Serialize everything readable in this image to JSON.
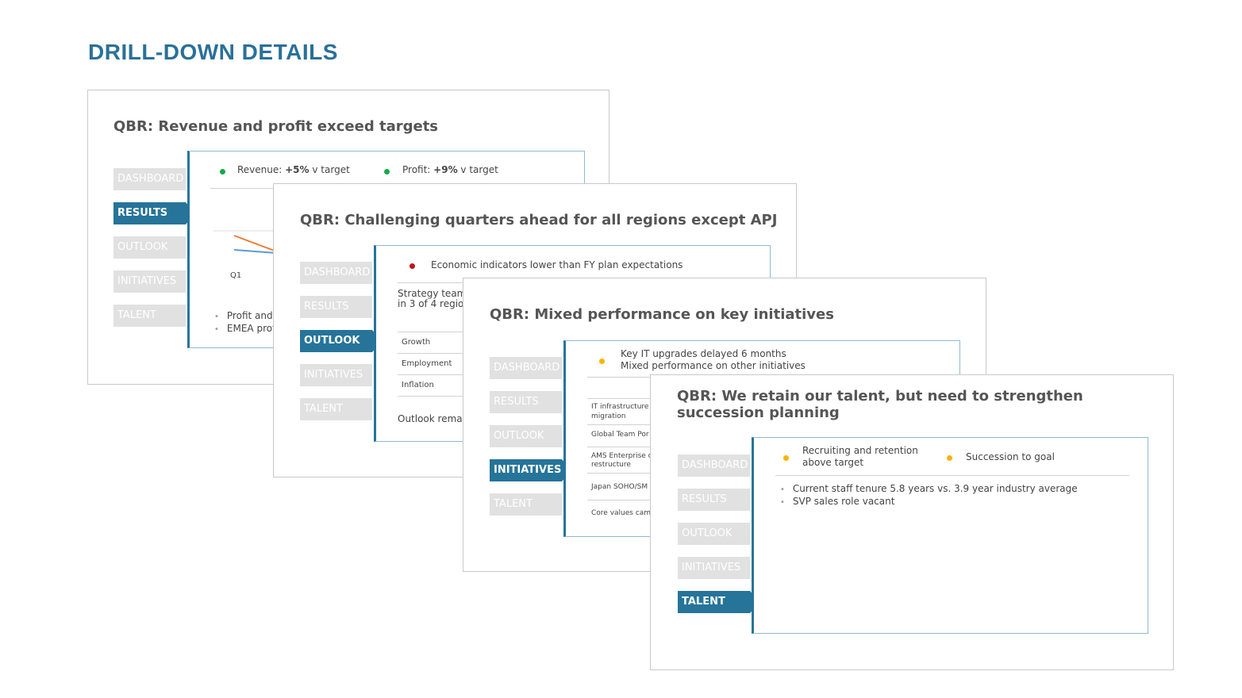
{
  "page_title": "DRILL-DOWN DETAILS",
  "nav_items": [
    "DASHBOARD",
    "RESULTS",
    "OUTLOOK",
    "INITIATIVES",
    "TALENT"
  ],
  "colors": {
    "accent": "#26749a",
    "title": "#2a7099",
    "green": "#17a84a",
    "red": "#c0141c",
    "amber": "#f7b500"
  },
  "slide1": {
    "title": "QBR: Revenue and profit exceed targets",
    "kpi_revenue_label": "Revenue: ",
    "kpi_revenue_value": "+5%",
    "kpi_revenue_suffix": " v target",
    "kpi_profit_label": "Profit: ",
    "kpi_profit_value": "+9%",
    "kpi_profit_suffix": " v target",
    "chart_tick": "Q1",
    "bullets": [
      "Profit and",
      "EMEA prof"
    ]
  },
  "slide2": {
    "title": "QBR: Challenging quarters ahead for all regions except APJ",
    "status": "Economic indicators lower than FY plan expectations",
    "note_line1": "Strategy team",
    "note_line2": "in 3 of 4 region",
    "rows": [
      "Growth",
      "Employment",
      "Inflation"
    ],
    "footer": "Outlook remai"
  },
  "slide3": {
    "title": "QBR: Mixed performance on key initiatives",
    "status_line1": "Key IT upgrades delayed 6 months",
    "status_line2": "Mixed performance on other initiatives",
    "rows": [
      [
        "IT infrastructure",
        "migration"
      ],
      [
        "Global Team Por"
      ],
      [
        "AMS Enterprise c",
        "restructure"
      ],
      [
        "Japan SOHO/SM"
      ],
      [
        "Core values cam"
      ]
    ]
  },
  "slide4": {
    "title_line1": "QBR: We retain our talent, but need to strengthen",
    "title_line2": "succession planning",
    "status1_line1": "Recruiting and retention",
    "status1_line2": "above target",
    "status2": "Succession to goal",
    "bullets": [
      "Current staff tenure 5.8 years vs. 3.9 year industry average",
      "SVP sales role vacant"
    ]
  }
}
